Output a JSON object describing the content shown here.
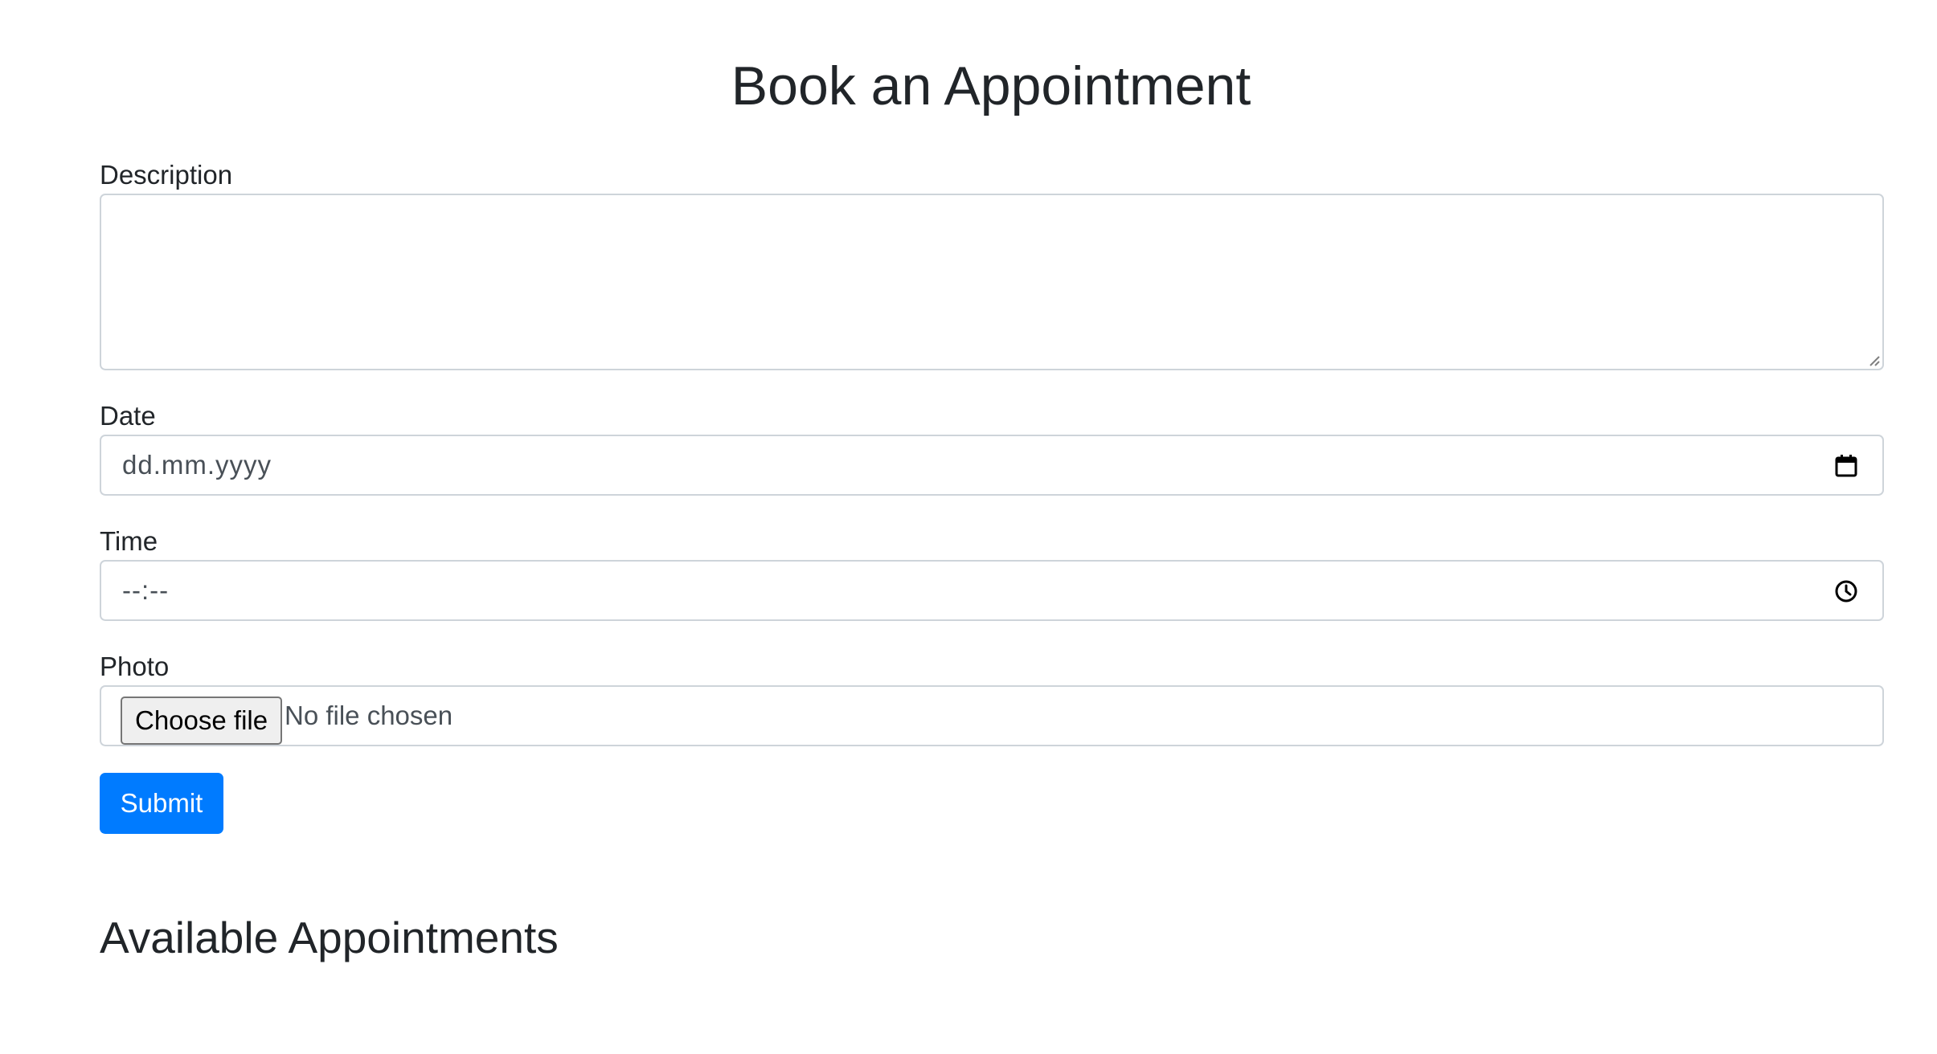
{
  "page": {
    "title": "Book an Appointment"
  },
  "form": {
    "description": {
      "label": "Description",
      "value": ""
    },
    "date": {
      "label": "Date",
      "placeholder": "dd.mm.yyyy",
      "icon": "calendar-icon"
    },
    "time": {
      "label": "Time",
      "placeholder": "--:--",
      "icon": "clock-icon"
    },
    "photo": {
      "label": "Photo",
      "button_label": "Choose file",
      "status": "No file chosen"
    },
    "submit_label": "Submit"
  },
  "appointments": {
    "heading": "Available Appointments"
  },
  "colors": {
    "primary": "#007bff",
    "border": "#ced4da",
    "text": "#212529"
  }
}
